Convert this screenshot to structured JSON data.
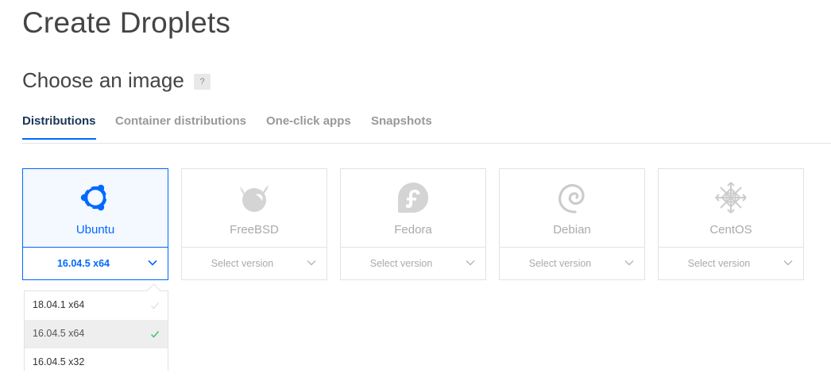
{
  "page": {
    "title": "Create Droplets"
  },
  "section": {
    "title": "Choose an image",
    "help": "?"
  },
  "tabs": [
    {
      "label": "Distributions"
    },
    {
      "label": "Container distributions"
    },
    {
      "label": "One-click apps"
    },
    {
      "label": "Snapshots"
    }
  ],
  "distros": [
    {
      "name": "Ubuntu",
      "version": "16.04.5 x64",
      "icon": "ubuntu-icon",
      "selected": true
    },
    {
      "name": "FreeBSD",
      "version": "Select version",
      "icon": "freebsd-icon"
    },
    {
      "name": "Fedora",
      "version": "Select version",
      "icon": "fedora-icon"
    },
    {
      "name": "Debian",
      "version": "Select version",
      "icon": "debian-icon"
    },
    {
      "name": "CentOS",
      "version": "Select version",
      "icon": "centos-icon"
    }
  ],
  "dropdown": {
    "options": [
      {
        "label": "18.04.1 x64"
      },
      {
        "label": "16.04.5 x64",
        "checked": true
      },
      {
        "label": "16.04.5 x32"
      }
    ]
  },
  "colors": {
    "accent": "#0069ff",
    "check": "#2ecc71",
    "muted": "#aaaaaa"
  }
}
